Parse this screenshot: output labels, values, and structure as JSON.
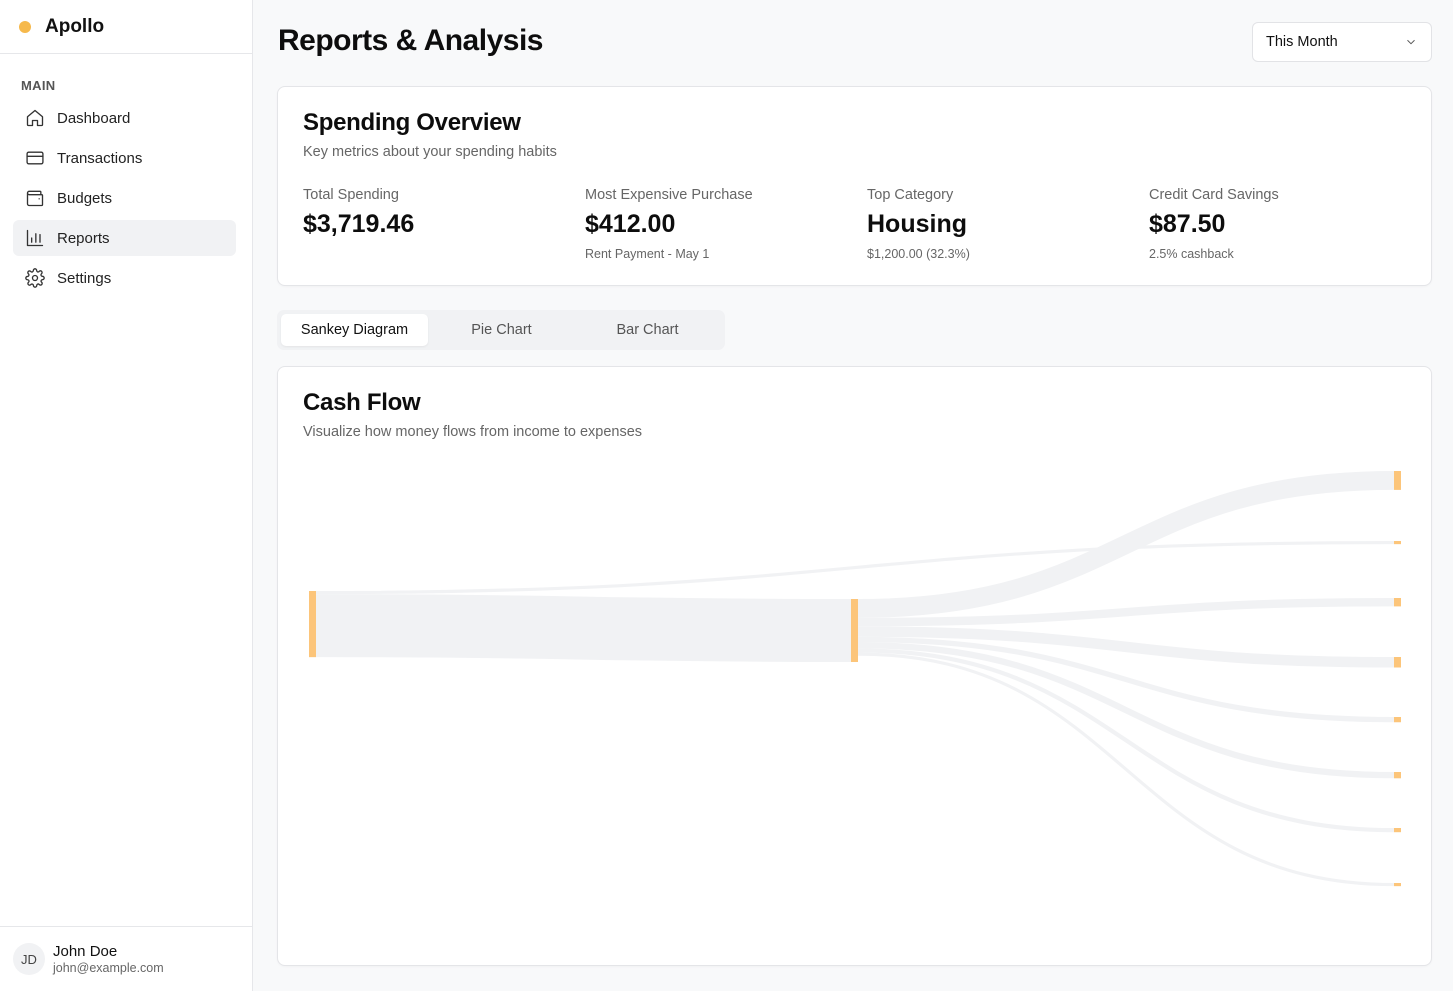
{
  "app": {
    "name": "Apollo",
    "accent": "#f6b94c"
  },
  "sidebar": {
    "section_label": "MAIN",
    "items": [
      {
        "label": "Dashboard",
        "icon": "home-icon",
        "active": false
      },
      {
        "label": "Transactions",
        "icon": "credit-card-icon",
        "active": false
      },
      {
        "label": "Budgets",
        "icon": "wallet-icon",
        "active": false
      },
      {
        "label": "Reports",
        "icon": "bar-chart-icon",
        "active": true
      },
      {
        "label": "Settings",
        "icon": "gear-icon",
        "active": false
      }
    ]
  },
  "user": {
    "initials": "JD",
    "name": "John Doe",
    "email": "john@example.com"
  },
  "header": {
    "title": "Reports & Analysis",
    "period": "This Month"
  },
  "overview": {
    "title": "Spending Overview",
    "subtitle": "Key metrics about your spending habits",
    "metrics": [
      {
        "label": "Total Spending",
        "value": "$3,719.46",
        "note": ""
      },
      {
        "label": "Most Expensive Purchase",
        "value": "$412.00",
        "note": "Rent Payment - May 1"
      },
      {
        "label": "Top Category",
        "value": "Housing",
        "note": "$1,200.00 (32.3%)"
      },
      {
        "label": "Credit Card Savings",
        "value": "$87.50",
        "note": "2.5% cashback"
      }
    ]
  },
  "tabs": [
    "Sankey Diagram",
    "Pie Chart",
    "Bar Chart"
  ],
  "active_tab": 0,
  "cashflow": {
    "title": "Cash Flow",
    "subtitle": "Visualize how money flows from income to expenses"
  },
  "chart_data": {
    "type": "sankey",
    "node_color": "#fcc57a",
    "link_color": "#f1f2f4",
    "nodes": [
      "source",
      "hub",
      "out1",
      "out2",
      "out3",
      "out4",
      "out5",
      "out6",
      "out7",
      "out8"
    ],
    "links": [
      {
        "from": "source",
        "to": "out2",
        "value": 3
      },
      {
        "from": "source",
        "to": "hub",
        "value": 60
      },
      {
        "from": "hub",
        "to": "out1",
        "value": 18
      },
      {
        "from": "hub",
        "to": "out3",
        "value": 8
      },
      {
        "from": "hub",
        "to": "out4",
        "value": 10
      },
      {
        "from": "hub",
        "to": "out5",
        "value": 5
      },
      {
        "from": "hub",
        "to": "out6",
        "value": 6
      },
      {
        "from": "hub",
        "to": "out7",
        "value": 4
      },
      {
        "from": "hub",
        "to": "out8",
        "value": 3
      }
    ]
  }
}
